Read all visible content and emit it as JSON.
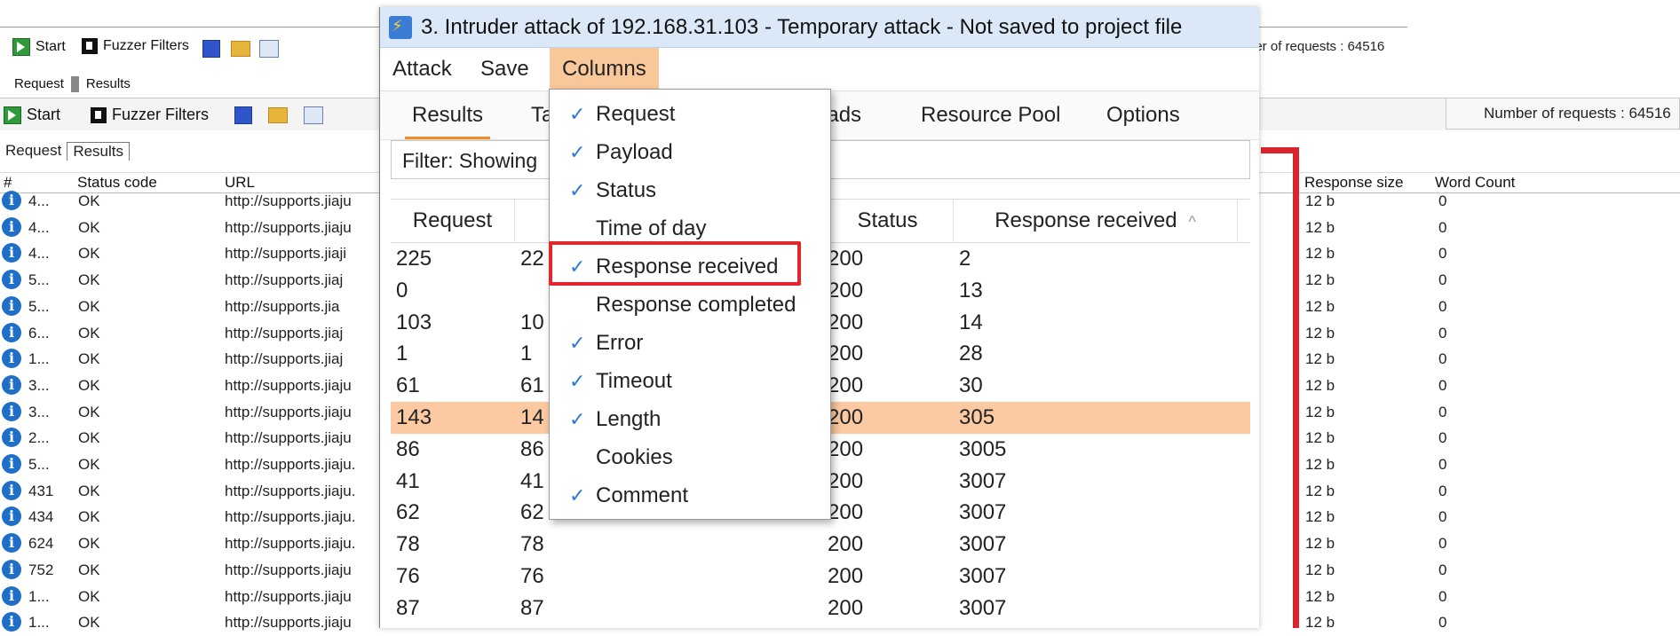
{
  "bg": {
    "toolbar_top": {
      "start": "Start",
      "fuzzer_filters": "Fuzzer Filters",
      "requests_count": "ber of requests : 64516"
    },
    "tabs_top": [
      "Request",
      "Results"
    ],
    "toolbar": {
      "start": "Start",
      "fuzzer_filters": "Fuzzer Filters",
      "requests_count": "Number of requests : 64516"
    },
    "tabs": [
      "Request",
      "Results"
    ],
    "columns": {
      "num": "#",
      "status": "Status code",
      "url": "URL",
      "response_size": "Response size",
      "word_count": "Word Count"
    },
    "rows": [
      {
        "num": "4...",
        "status": "OK",
        "url": "http://supports.jiaju",
        "size": "12 b",
        "words": "0"
      },
      {
        "num": "4...",
        "status": "OK",
        "url": "http://supports.jiaju",
        "size": "12 b",
        "words": "0"
      },
      {
        "num": "4...",
        "status": "OK",
        "url": "http://supports.jiaji",
        "size": "12 b",
        "words": "0"
      },
      {
        "num": "5...",
        "status": "OK",
        "url": "http://supports.jiaj",
        "size": "12 b",
        "words": "0"
      },
      {
        "num": "5...",
        "status": "OK",
        "url": "http://supports.jia",
        "size": "12 b",
        "words": "0"
      },
      {
        "num": "6...",
        "status": "OK",
        "url": "http://supports.jiaj",
        "size": "12 b",
        "words": "0"
      },
      {
        "num": "1...",
        "status": "OK",
        "url": "http://supports.jiaj",
        "size": "12 b",
        "words": "0"
      },
      {
        "num": "3...",
        "status": "OK",
        "url": "http://supports.jiaju",
        "size": "12 b",
        "words": "0"
      },
      {
        "num": "3...",
        "status": "OK",
        "url": "http://supports.jiaju",
        "size": "12 b",
        "words": "0"
      },
      {
        "num": "2...",
        "status": "OK",
        "url": "http://supports.jiaju",
        "size": "12 b",
        "words": "0"
      },
      {
        "num": "5...",
        "status": "OK",
        "url": "http://supports.jiaju.",
        "size": "12 b",
        "words": "0"
      },
      {
        "num": "431",
        "status": "OK",
        "url": "http://supports.jiaju.",
        "size": "12 b",
        "words": "0"
      },
      {
        "num": "434",
        "status": "OK",
        "url": "http://supports.jiaju.",
        "size": "12 b",
        "words": "0"
      },
      {
        "num": "624",
        "status": "OK",
        "url": "http://supports.jiaju.",
        "size": "12 b",
        "words": "0"
      },
      {
        "num": "752",
        "status": "OK",
        "url": "http://supports.jiaju",
        "size": "12 b",
        "words": "0"
      },
      {
        "num": "1...",
        "status": "OK",
        "url": "http://supports.jiaju",
        "size": "12 b",
        "words": "0"
      },
      {
        "num": "1...",
        "status": "OK",
        "url": "http://supports.jiaju",
        "size": "12 b",
        "words": "0"
      }
    ]
  },
  "dialog": {
    "title": "3. Intruder attack of 192.168.31.103 - Temporary attack - Not saved to project file",
    "menu": [
      "Attack",
      "Save",
      "Columns"
    ],
    "tabs": [
      "Results",
      "Ta",
      "oads",
      "Resource Pool",
      "Options"
    ],
    "filter": "Filter: Showing",
    "table": {
      "headers": [
        "Request",
        "Status",
        "Response received"
      ],
      "sort_indicator": "^",
      "rows": [
        {
          "request": "225",
          "payload": "22",
          "status": "200",
          "received": "2"
        },
        {
          "request": "0",
          "payload": "",
          "status": "200",
          "received": "13"
        },
        {
          "request": "103",
          "payload": "10",
          "status": "200",
          "received": "14"
        },
        {
          "request": "1",
          "payload": "1",
          "status": "200",
          "received": "28"
        },
        {
          "request": "61",
          "payload": "61",
          "status": "200",
          "received": "30"
        },
        {
          "request": "143",
          "payload": "14",
          "status": "200",
          "received": "305"
        },
        {
          "request": "86",
          "payload": "86",
          "status": "200",
          "received": "3005"
        },
        {
          "request": "41",
          "payload": "41",
          "status": "200",
          "received": "3007"
        },
        {
          "request": "62",
          "payload": "62",
          "status": "200",
          "received": "3007"
        },
        {
          "request": "78",
          "payload": "78",
          "status": "200",
          "received": "3007"
        },
        {
          "request": "76",
          "payload": "76",
          "status": "200",
          "received": "3007"
        },
        {
          "request": "87",
          "payload": "87",
          "status": "200",
          "received": "3007"
        }
      ],
      "highlight_color": "#fbc9a2"
    }
  },
  "dropdown": {
    "items": [
      {
        "label": "Request",
        "check": "✓"
      },
      {
        "label": "Payload",
        "check": "✓"
      },
      {
        "label": "Status",
        "check": "✓"
      },
      {
        "label": "Time of day",
        "check": ""
      },
      {
        "label": "Response received",
        "check": "✓"
      },
      {
        "label": "Response completed",
        "check": ""
      },
      {
        "label": "Error",
        "check": "✓"
      },
      {
        "label": "Timeout",
        "check": "✓"
      },
      {
        "label": "Length",
        "check": "✓"
      },
      {
        "label": "Cookies",
        "check": ""
      },
      {
        "label": "Comment",
        "check": "✓"
      }
    ]
  },
  "colors": {
    "accent_orange": "#f48a2a",
    "menu_open": "#f8c89a",
    "annotation_red": "#d8262c",
    "check_blue": "#2b7ad6",
    "title_bar": "#dbe8f8"
  },
  "icons": [
    "start-icon",
    "fuzzer-filter-icon",
    "save-icon",
    "open-folder-icon",
    "export-icon",
    "info-icon",
    "intruder-bolt-icon",
    "check-icon"
  ]
}
